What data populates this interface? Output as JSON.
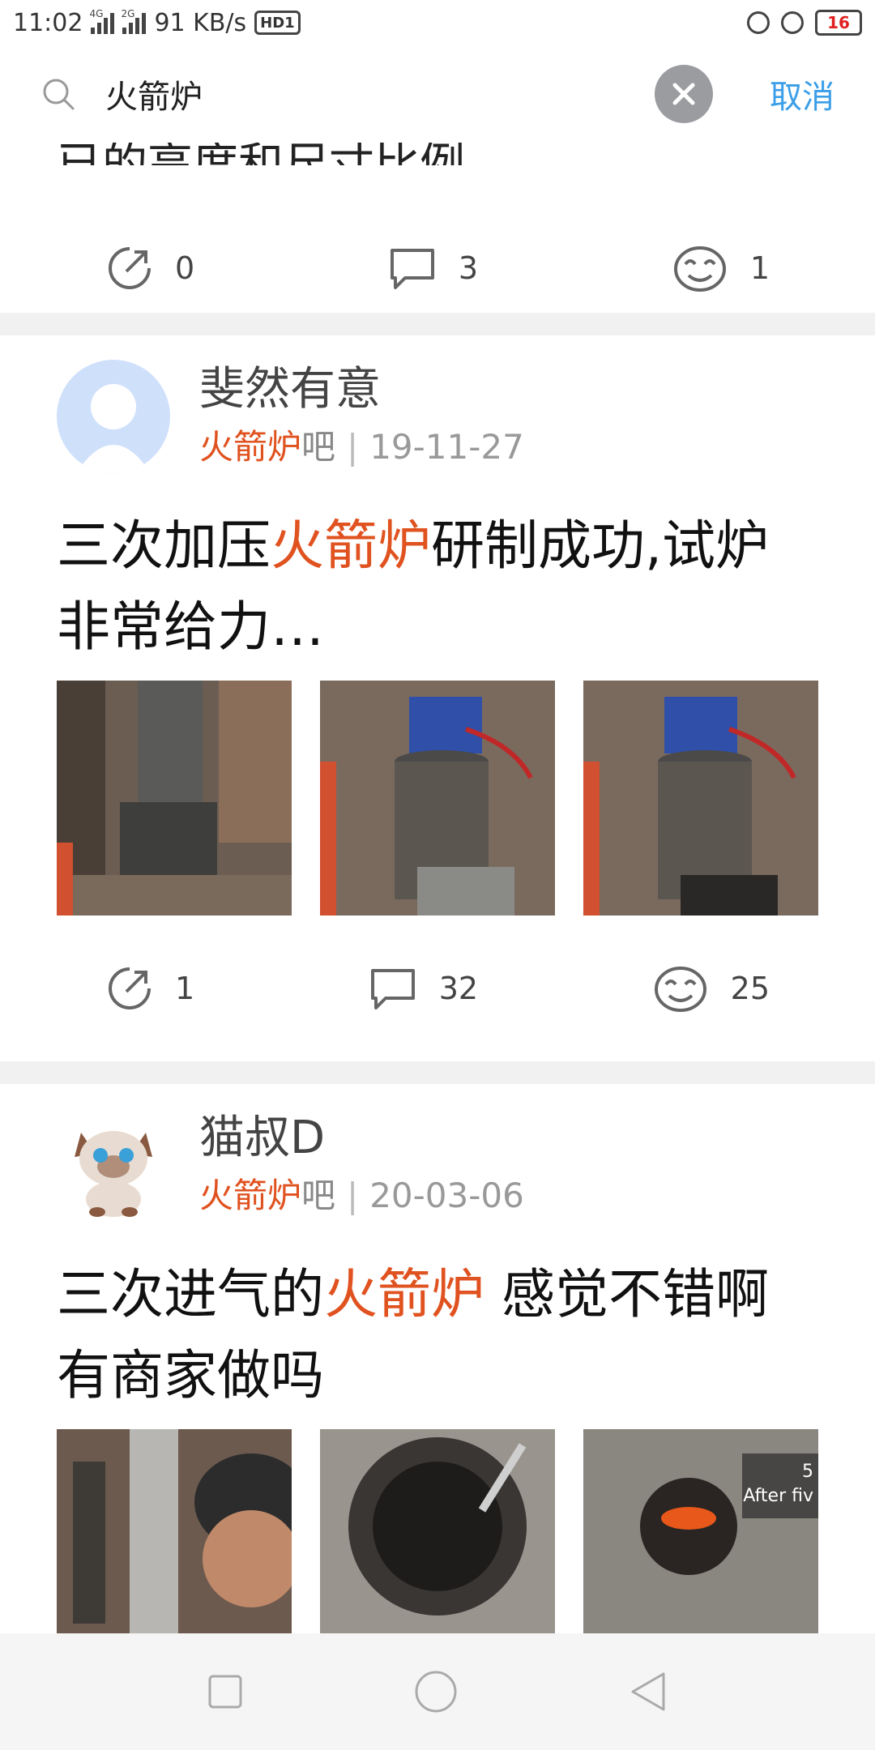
{
  "status_bar": {
    "time": "11:02",
    "net_tag_1": "4G",
    "net_tag_2": "2G",
    "speed": "91 KB/s",
    "hd_badge": "HD1",
    "battery": "16"
  },
  "search": {
    "query": "火箭炉",
    "cancel_label": "取消"
  },
  "previous_post": {
    "partial_title": "已的高度和尺寸比例…",
    "share_count": "0",
    "comment_count": "3",
    "like_count": "1"
  },
  "posts": [
    {
      "username": "斐然有意",
      "forum_name": "火箭炉",
      "forum_suffix": "吧",
      "separator": "|",
      "date": "19-11-27",
      "title_pre": "三次加压",
      "title_hl": "火箭炉",
      "title_post": "研制成功,试炉非常给力…",
      "share_count": "1",
      "comment_count": "32",
      "like_count": "25"
    },
    {
      "username": "猫叔D",
      "forum_name": "火箭炉",
      "forum_suffix": "吧",
      "separator": "|",
      "date": "20-03-06",
      "title_pre": "三次进气的",
      "title_hl": "火箭炉",
      "title_post": " 感觉不错啊 有商家做吗",
      "video_overlay_line1": "5",
      "video_overlay_line2": "After fiv"
    }
  ],
  "colors": {
    "highlight": "#e0521f",
    "cancel": "#3a9ee8",
    "divider": "#f1f1f1"
  },
  "icons": [
    "search-icon",
    "clear-icon",
    "share-icon",
    "comment-icon",
    "like-icon",
    "back-icon",
    "home-icon",
    "recents-icon"
  ]
}
